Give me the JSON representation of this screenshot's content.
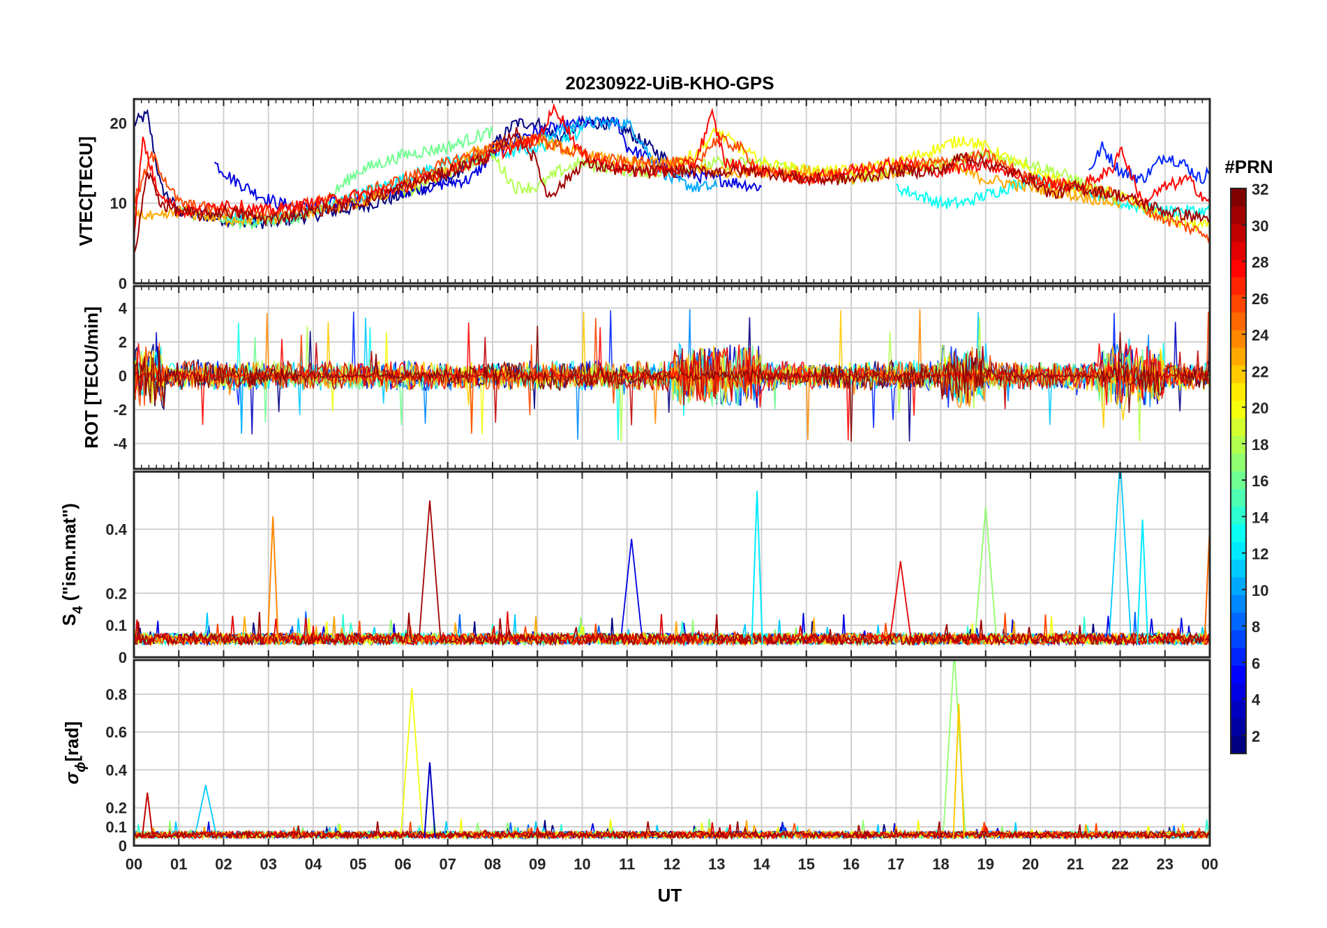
{
  "title": "20230922-UiB-KHO-GPS",
  "xlabel": "UT",
  "x_ticks": [
    "00",
    "01",
    "02",
    "03",
    "04",
    "05",
    "06",
    "07",
    "08",
    "09",
    "10",
    "11",
    "12",
    "13",
    "14",
    "15",
    "16",
    "17",
    "18",
    "19",
    "20",
    "21",
    "22",
    "23",
    "00"
  ],
  "colorbar": {
    "label": "#PRN",
    "ticks": [
      "2",
      "4",
      "6",
      "8",
      "10",
      "12",
      "14",
      "16",
      "18",
      "20",
      "22",
      "24",
      "26",
      "28",
      "30",
      "32"
    ],
    "range": [
      1,
      32
    ],
    "colormap": "jet"
  },
  "chart_data": [
    {
      "type": "line",
      "panel": "VTEC",
      "ylabel": "VTEC[TECU]",
      "ylim": [
        0,
        23
      ],
      "yticks": [
        0,
        10,
        20
      ],
      "xlim": [
        0,
        24
      ],
      "grid": true,
      "series": [
        {
          "prn": 1,
          "x": [
            0,
            0.3,
            0.6,
            1,
            1.5,
            2,
            3,
            4,
            5,
            6,
            7,
            8,
            8.5,
            9,
            9.5,
            10,
            10.5,
            11,
            11.5,
            12
          ],
          "y": [
            20,
            21,
            12,
            9,
            8.5,
            8,
            7.5,
            8.5,
            9.5,
            11,
            13,
            17,
            20,
            20,
            18,
            20,
            20,
            19,
            17,
            15
          ]
        },
        {
          "prn": 4,
          "x": [
            1.8,
            2.2,
            2.8,
            3.2,
            3.8,
            4.5,
            5.5,
            6.5,
            7.5,
            8,
            8.5,
            9,
            10,
            10.8,
            11,
            12,
            13,
            14
          ],
          "y": [
            15,
            13,
            11,
            10,
            9.5,
            10,
            11,
            12,
            13,
            16,
            18,
            19,
            20,
            20,
            17,
            14,
            13,
            12
          ]
        },
        {
          "prn": 6,
          "x": [
            21.3,
            21.6,
            22,
            22.5,
            23,
            23.4,
            23.8,
            24
          ],
          "y": [
            14,
            17,
            14,
            13,
            16,
            15,
            13,
            14
          ]
        },
        {
          "prn": 10,
          "x": [
            9,
            9.5,
            10,
            10.5,
            11,
            11.3,
            11.6,
            12,
            12.5,
            13
          ],
          "y": [
            18,
            19,
            20,
            20,
            20,
            18,
            15,
            13,
            12,
            12
          ]
        },
        {
          "prn": 12,
          "x": [
            2,
            3,
            4,
            5,
            6,
            7,
            8,
            9,
            9.5,
            10
          ],
          "y": [
            8,
            8,
            9,
            11,
            13,
            15,
            16,
            17,
            18,
            19
          ]
        },
        {
          "prn": 13,
          "x": [
            17,
            17.5,
            18,
            18.5,
            19,
            19.5,
            20,
            21,
            22,
            23,
            24
          ],
          "y": [
            12,
            11,
            10,
            10,
            11,
            12,
            13,
            12,
            10,
            9,
            9
          ]
        },
        {
          "prn": 16,
          "x": [
            1,
            2,
            2.5,
            3,
            3.5,
            4,
            5,
            6,
            7,
            8
          ],
          "y": [
            9,
            8,
            7.5,
            8,
            7.5,
            9,
            14,
            16,
            17,
            19
          ]
        },
        {
          "prn": 18,
          "x": [
            6,
            7,
            8,
            8.5,
            9,
            9.5,
            10,
            11,
            12,
            13,
            14,
            15,
            16,
            17,
            18,
            19,
            20,
            21,
            22
          ],
          "y": [
            11,
            14,
            16,
            12,
            12,
            14,
            15,
            14,
            14,
            15,
            15,
            14,
            13,
            14,
            15,
            16,
            15,
            13,
            10
          ]
        },
        {
          "prn": 20,
          "x": [
            12,
            12.5,
            13,
            13.5,
            14,
            15,
            16,
            17,
            17.5,
            18,
            18.5,
            19,
            20,
            21,
            22,
            23,
            24
          ],
          "y": [
            15,
            16,
            19,
            17,
            15,
            14,
            14,
            15,
            16,
            17,
            18,
            17,
            14,
            12,
            11,
            8,
            7
          ]
        },
        {
          "prn": 23,
          "x": [
            0,
            0.5,
            1,
            2,
            3,
            4,
            5,
            6,
            7,
            7.5,
            8,
            9,
            10,
            11,
            12,
            13,
            14,
            15,
            16,
            17,
            18,
            19,
            20,
            21,
            22
          ],
          "y": [
            9,
            8,
            9,
            8,
            8,
            9,
            10,
            12,
            14,
            16,
            17,
            18,
            16,
            15,
            15,
            14,
            14,
            14,
            13,
            14,
            15,
            13,
            12,
            11,
            10
          ]
        },
        {
          "prn": 26,
          "x": [
            0,
            0.4,
            1,
            2,
            3,
            4,
            5,
            6,
            7,
            8,
            9,
            10,
            11,
            12,
            12.5,
            13,
            13.5,
            14,
            15,
            16,
            17,
            18,
            19,
            20,
            21,
            22,
            23,
            24
          ],
          "y": [
            10,
            16,
            10,
            9,
            9,
            10,
            11,
            13,
            15,
            17,
            18,
            16,
            15,
            15,
            15,
            18,
            17,
            14,
            13,
            14,
            15,
            15,
            16,
            13,
            12,
            11,
            8,
            6
          ]
        },
        {
          "prn": 28,
          "x": [
            0,
            0.2,
            0.5,
            1,
            1.5,
            2,
            3,
            4,
            5,
            6,
            7,
            8,
            9,
            9.4,
            10,
            11,
            12,
            12.5,
            12.9,
            13.2,
            14,
            15,
            16,
            17,
            18,
            19,
            20,
            21,
            21.8,
            22,
            22.5,
            23,
            23.5,
            24
          ],
          "y": [
            6,
            18,
            12,
            9,
            9,
            10,
            9,
            10,
            11,
            12,
            14,
            16,
            18,
            22,
            16,
            14,
            14,
            15,
            21,
            15,
            14,
            13,
            14,
            15,
            14,
            15,
            13,
            12,
            14,
            17,
            10,
            12,
            13,
            10
          ]
        },
        {
          "prn": 31,
          "x": [
            0,
            0.3,
            0.6,
            1,
            1.5,
            2,
            3,
            4,
            5,
            6,
            7,
            8,
            8.5,
            9,
            9.2,
            9.5,
            10,
            11,
            12,
            13,
            14,
            15,
            16,
            17,
            18,
            18.5,
            19,
            19.5,
            20,
            20.5,
            21,
            22,
            23,
            24
          ],
          "y": [
            3,
            14,
            10,
            9,
            8.5,
            9,
            8,
            9,
            10,
            12,
            14,
            16,
            19,
            15,
            11,
            12,
            15,
            14,
            14,
            14,
            14,
            13,
            13,
            14,
            14,
            16,
            15,
            14,
            13,
            11,
            12,
            11,
            9,
            8
          ]
        }
      ]
    },
    {
      "type": "line",
      "panel": "ROT",
      "ylabel": "ROT [TECU/min]",
      "ylim": [
        -5.5,
        5.3
      ],
      "yticks": [
        -4,
        -2,
        0,
        2,
        4
      ],
      "xlim": [
        0,
        24
      ],
      "grid": true,
      "note_series": "Dense noise around 0 for all PRNs, spikes up to about ±4.5"
    },
    {
      "type": "line",
      "panel": "S4",
      "ylabel": "S4 (\"ism.mat\")",
      "ylim": [
        0,
        0.58
      ],
      "yticks": [
        0,
        0.1,
        0.2,
        0.4
      ],
      "xlim": [
        0,
        24
      ],
      "grid": true,
      "peaks": [
        {
          "prn": 24,
          "x": 3.1,
          "y": 0.44
        },
        {
          "prn": 31,
          "x": 6.6,
          "y": 0.45
        },
        {
          "prn": 4,
          "x": 11.1,
          "y": 0.33
        },
        {
          "prn": 12,
          "x": 13.9,
          "y": 0.52
        },
        {
          "prn": 29,
          "x": 17.1,
          "y": 0.26
        },
        {
          "prn": 17,
          "x": 19.0,
          "y": 0.43
        },
        {
          "prn": 11,
          "x": 22.0,
          "y": 0.58
        },
        {
          "prn": 12,
          "x": 22.5,
          "y": 0.43
        },
        {
          "prn": 25,
          "x": 24.0,
          "y": 0.41
        }
      ]
    },
    {
      "type": "line",
      "panel": "sigma_phi",
      "ylabel": "σϕ[rad]",
      "ylim": [
        0,
        0.98
      ],
      "yticks": [
        0,
        0.1,
        0.2,
        0.4,
        0.6,
        0.8
      ],
      "xlim": [
        0,
        24
      ],
      "grid": true,
      "peaks": [
        {
          "prn": 20,
          "x": 6.2,
          "y": 0.79
        },
        {
          "prn": 3,
          "x": 6.6,
          "y": 0.44
        },
        {
          "prn": 17,
          "x": 18.3,
          "y": 0.98
        },
        {
          "prn": 22,
          "x": 18.4,
          "y": 0.75
        },
        {
          "prn": 11,
          "x": 1.6,
          "y": 0.28
        },
        {
          "prn": 30,
          "x": 0.3,
          "y": 0.28
        }
      ]
    }
  ]
}
